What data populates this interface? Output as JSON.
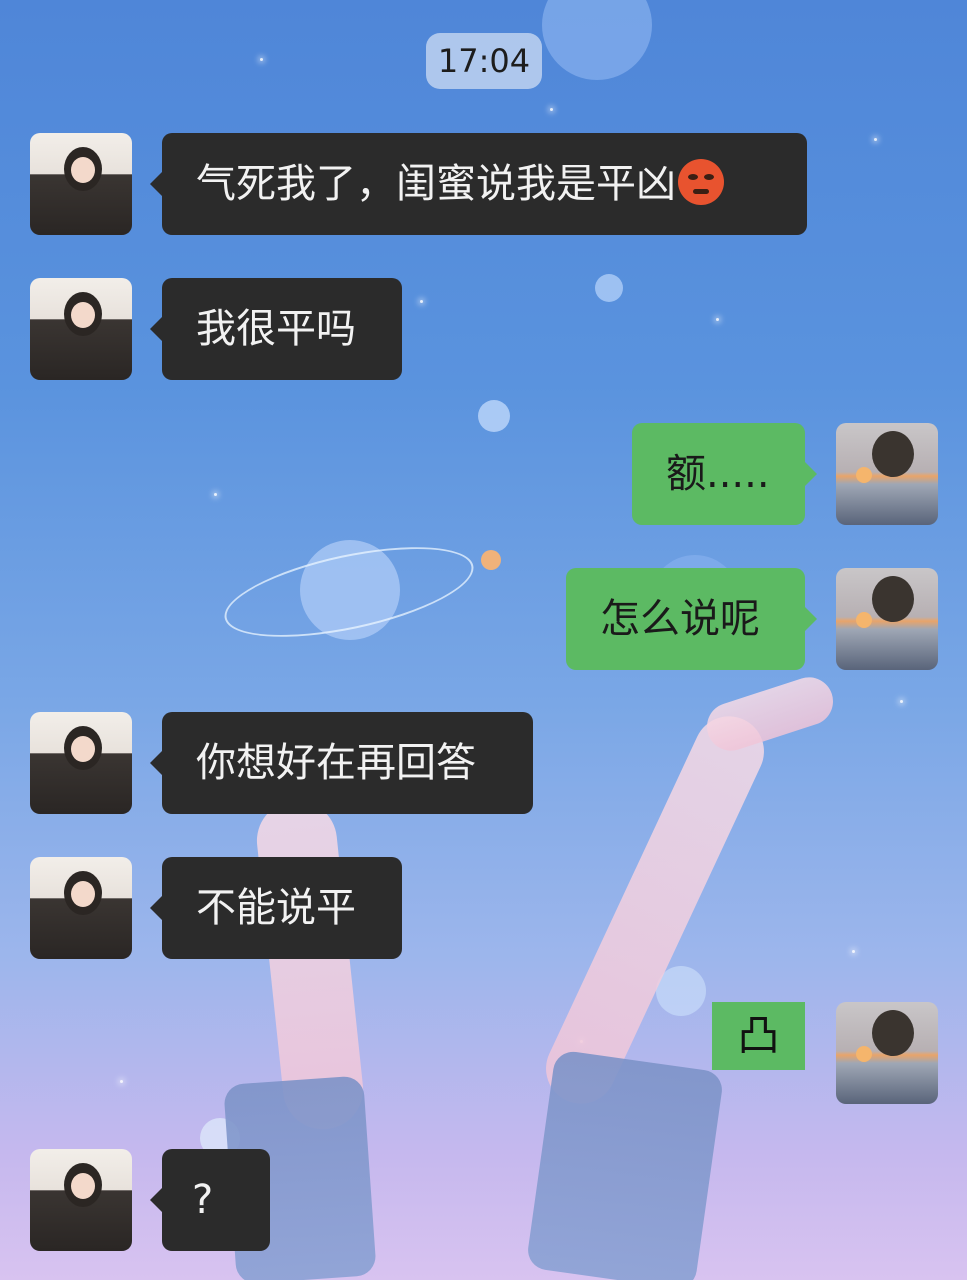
{
  "chat": {
    "timestamp": "17:04",
    "messages": [
      {
        "sender": "friend",
        "text": "气死我了，闺蜜说我是平凶",
        "emoji": "angry-face-icon"
      },
      {
        "sender": "friend",
        "text": "我很平吗"
      },
      {
        "sender": "me",
        "text": "额....."
      },
      {
        "sender": "me",
        "text": "怎么说呢"
      },
      {
        "sender": "friend",
        "text": "你想好在再回答"
      },
      {
        "sender": "friend",
        "text": "不能说平"
      },
      {
        "sender": "me",
        "text": "凸",
        "sticker": "false-mark"
      },
      {
        "sender": "friend",
        "text": "?"
      }
    ]
  }
}
